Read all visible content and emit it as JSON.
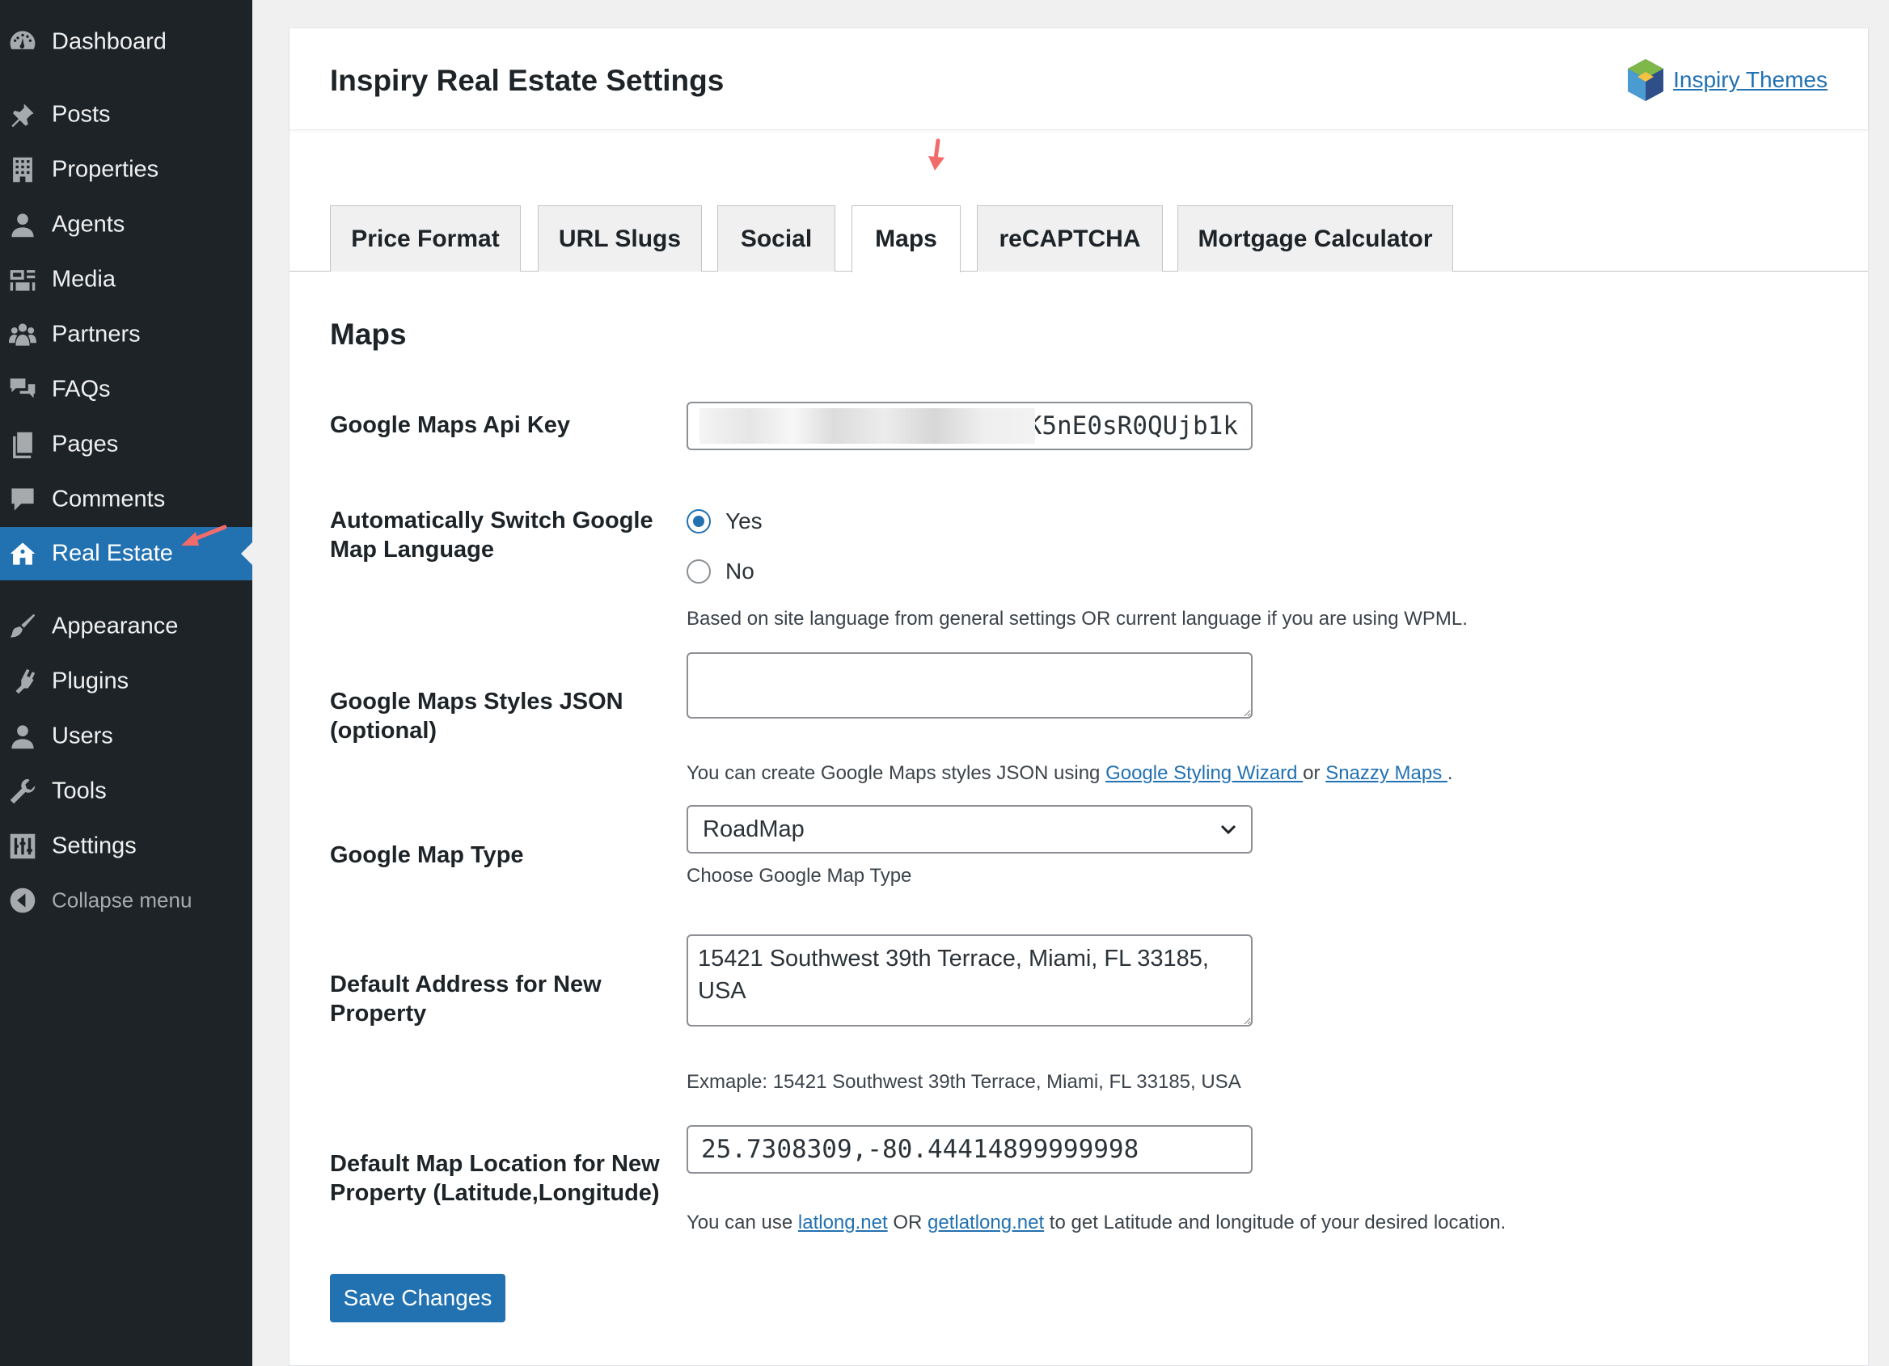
{
  "sidebar": {
    "items": [
      {
        "label": "Dashboard",
        "icon": "dashboard-icon"
      },
      {
        "label": "Posts",
        "icon": "pin-icon"
      },
      {
        "label": "Properties",
        "icon": "building-icon"
      },
      {
        "label": "Agents",
        "icon": "user-icon"
      },
      {
        "label": "Media",
        "icon": "media-icon"
      },
      {
        "label": "Partners",
        "icon": "groups-icon"
      },
      {
        "label": "FAQs",
        "icon": "chat-bubbles-icon"
      },
      {
        "label": "Pages",
        "icon": "page-icon"
      },
      {
        "label": "Comments",
        "icon": "comment-icon"
      },
      {
        "label": "Real Estate",
        "icon": "houses-icon",
        "current": true
      },
      {
        "label": "Appearance",
        "icon": "brush-icon"
      },
      {
        "label": "Plugins",
        "icon": "plug-icon"
      },
      {
        "label": "Users",
        "icon": "user-icon"
      },
      {
        "label": "Tools",
        "icon": "wrench-icon"
      },
      {
        "label": "Settings",
        "icon": "sliders-icon"
      }
    ],
    "collapse_label": "Collapse menu"
  },
  "header": {
    "title": "Inspiry Real Estate Settings",
    "brand_link": "Inspiry Themes"
  },
  "tabs": [
    {
      "label": "Price Format"
    },
    {
      "label": "URL Slugs"
    },
    {
      "label": "Social"
    },
    {
      "label": "Maps",
      "active": true
    },
    {
      "label": "reCAPTCHA"
    },
    {
      "label": "Mortgage Calculator"
    }
  ],
  "section": {
    "heading": "Maps",
    "api_key": {
      "label": "Google Maps Api Key",
      "value": "wK5nE0sR0QUjb1k"
    },
    "auto_language": {
      "label": "Automatically Switch Google Map Language",
      "options": [
        "Yes",
        "No"
      ],
      "selected": "Yes",
      "description": "Based on site language from general settings OR current language if you are using WPML."
    },
    "styles_json": {
      "label": "Google Maps Styles JSON (optional)",
      "value": "",
      "desc_prefix": "You can create Google Maps styles JSON using ",
      "link1": "Google Styling Wizard ",
      "desc_mid": "or ",
      "link2": "Snazzy Maps ",
      "desc_suffix": "."
    },
    "map_type": {
      "label": "Google Map Type",
      "selected": "RoadMap",
      "description": "Choose Google Map Type"
    },
    "default_address": {
      "label": "Default Address for New Property",
      "value": "15421 Southwest 39th Terrace, Miami, FL 33185, USA",
      "description": "Exmaple: 15421 Southwest 39th Terrace, Miami, FL 33185, USA"
    },
    "default_location": {
      "label": "Default Map Location for New Property (Latitude,Longitude)",
      "value": "25.7308309,-80.44414899999998",
      "desc_prefix": "You can use ",
      "link1": "latlong.net",
      "desc_mid": " OR ",
      "link2": "getlatlong.net",
      "desc_suffix": " to get Latitude and longitude of your desired location."
    }
  },
  "save_label": "Save Changes",
  "colors": {
    "sidebar_bg": "#1d2327",
    "accent": "#2271b1",
    "annotation_arrow": "#f26b6b"
  }
}
